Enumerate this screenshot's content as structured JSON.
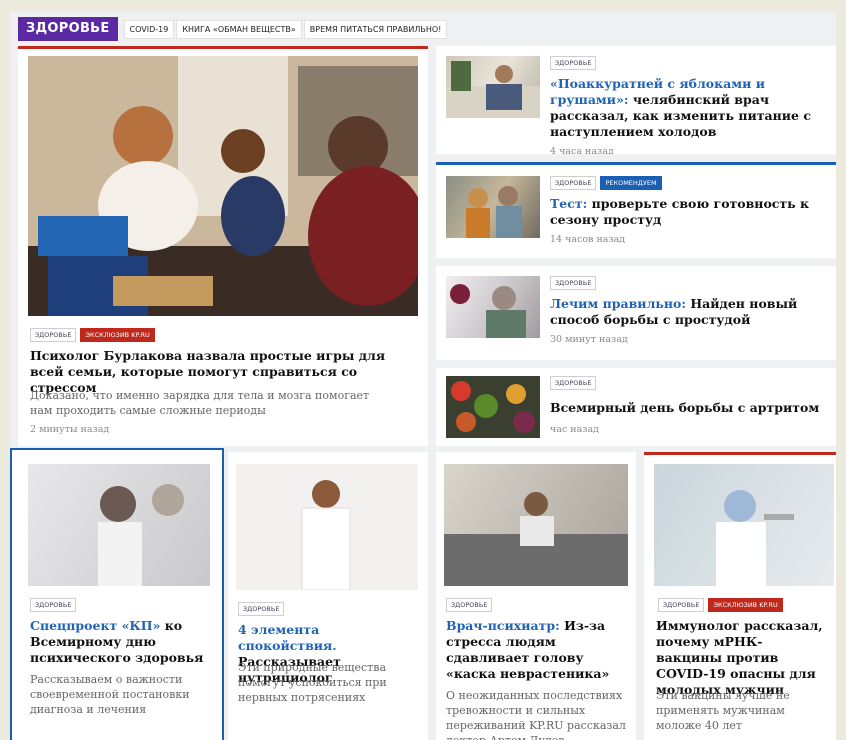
{
  "header": {
    "rubric": "ЗДОРОВЬЕ",
    "tags": [
      "COVID-19",
      "КНИГА «ОБМАН ВЕЩЕСТВ»",
      "ВРЕМЯ ПИТАТЬСЯ ПРАВИЛЬНО!"
    ]
  },
  "main": {
    "tags": [
      "ЗДОРОВЬЕ",
      "ЭКСКЛЮЗИВ KP.RU"
    ],
    "title": "Психолог Бурлакова назвала простые игры для всей семьи, которые помогут справиться со стрессом",
    "lead": "Доказано, что именно зарядка для тела и мозга помогает нам проходить самые сложные периоды",
    "time": "2 минуты назад"
  },
  "side": [
    {
      "tags": [
        "ЗДОРОВЬЕ"
      ],
      "highlight": "«Поаккуратней с яблоками и грушами»:",
      "title": "челябинский врач рассказал, как изменить питание с наступлением холодов",
      "time": "4 часа назад"
    },
    {
      "tags": [
        "ЗДОРОВЬЕ",
        "РЕКОМЕНДУЕМ"
      ],
      "highlight": "Тест:",
      "title": "проверьте свою готовность к сезону простуд",
      "time": "14 часов назад"
    },
    {
      "tags": [
        "ЗДОРОВЬЕ"
      ],
      "highlight": "Лечим правильно:",
      "title": "Найден новый способ борьбы с простудой",
      "time": "30 минут назад"
    },
    {
      "tags": [
        "ЗДОРОВЬЕ"
      ],
      "highlight": "",
      "title": "Всемирный день борьбы с артритом",
      "time": "час назад"
    }
  ],
  "bottom": [
    {
      "tags": [
        "ЗДОРОВЬЕ"
      ],
      "highlight": "Спецпроект «КП»",
      "title": "ко Всемирному дню психического здоровья",
      "lead": "Рассказываем о важности своевременной постановки диагноза и лечения"
    },
    {
      "tags": [
        "ЗДОРОВЬЕ"
      ],
      "highlight": "4 элемента спокойствия.",
      "title": "Рассказывает нутрициолог",
      "lead": "Эти природные вещества помогут успокоиться при нервных потрясениях"
    },
    {
      "tags": [
        "ЗДОРОВЬЕ"
      ],
      "highlight": "Врач-психиатр:",
      "title": "Из-за стресса людям сдавливает голову «каска неврастеника»",
      "lead": "О неожиданных последствиях тревожности и сильных переживаний KP.RU рассказал доктор Артем Дудев"
    },
    {
      "tags": [
        "ЗДОРОВЬЕ",
        "ЭКСКЛЮЗИВ KP.RU"
      ],
      "highlight": "",
      "title": "Иммунолог рассказал, почему мРНК-вакцины против COVID-19 опасны для молодых мужчин",
      "lead": "Эти вакцины лучше не применять мужчинам моложе 40 лет"
    }
  ],
  "colors": {
    "rubric": "#5b2aa2",
    "accent_red": "#c0281c",
    "accent_blue": "#1b5fb3",
    "link": "#1f63b7"
  }
}
